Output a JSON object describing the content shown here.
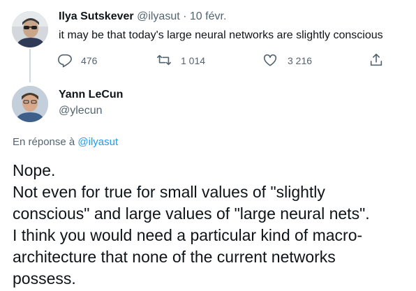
{
  "tweet1": {
    "name": "Ilya Sutskever",
    "handle": "@ilyasut",
    "separator": "·",
    "date": "10 févr.",
    "text": "it may be that today's large neural networks are slightly conscious",
    "actions": {
      "reply_count": "476",
      "retweet_count": "1 014",
      "like_count": "3 216"
    }
  },
  "tweet2": {
    "name": "Yann LeCun",
    "handle": "@ylecun",
    "replying_prefix": "En réponse à",
    "replying_handle": "@ilyasut",
    "lines": [
      "Nope.",
      "Not even for true for small values of \"slightly",
      "conscious\" and large values of \"large neural nets\".",
      "I think you would need a particular kind of macro-",
      "architecture that none of the current networks",
      "possess."
    ]
  },
  "colors": {
    "text": "#0f1419",
    "secondary": "#536471",
    "link": "#1d9bf0",
    "thread_line": "#cfd9de"
  },
  "icons": [
    "reply-icon",
    "retweet-icon",
    "like-icon",
    "share-icon"
  ]
}
